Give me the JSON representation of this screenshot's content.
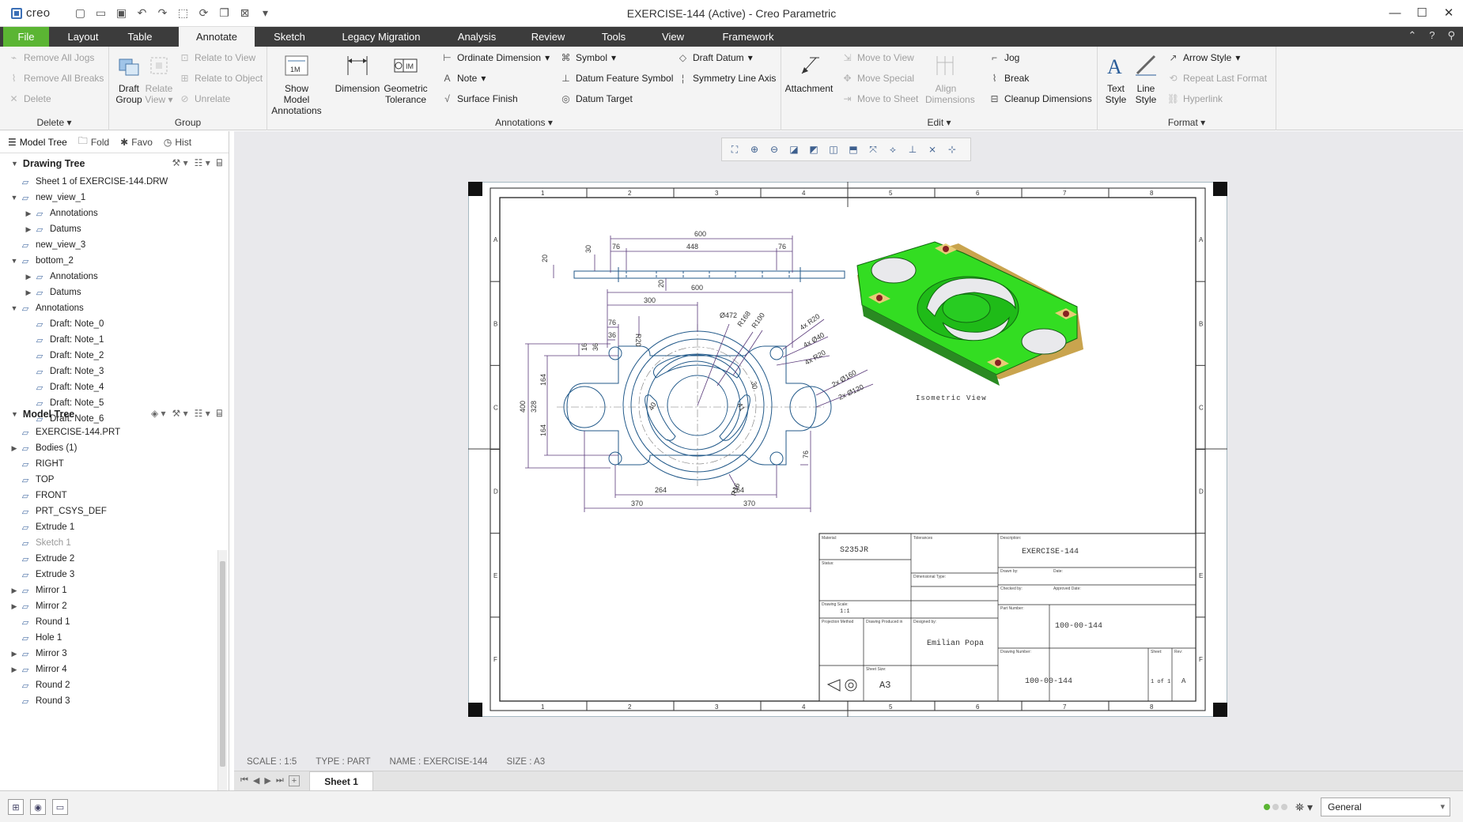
{
  "app": {
    "logo_text": "creo",
    "window_title": "EXERCISE-144 (Active) - Creo Parametric"
  },
  "quick_access": [
    "new-icon",
    "open-icon",
    "save-icon",
    "undo-icon",
    "redo-icon",
    "select-box-icon",
    "regenerate-icon",
    "windows-icon",
    "close-window-icon",
    "customize-icon"
  ],
  "tabs": [
    "File",
    "Layout",
    "Table",
    "Annotate",
    "Sketch",
    "Legacy Migration",
    "Analysis",
    "Review",
    "Tools",
    "View",
    "Framework"
  ],
  "active_tab": "Annotate",
  "ribbon": {
    "delete": {
      "label": "Delete",
      "items": [
        "Remove All Jogs",
        "Remove All Breaks",
        "Delete"
      ]
    },
    "group": {
      "label": "Group",
      "draft_group": "Draft Group",
      "relate_view": "Relate View",
      "items": [
        "Relate to View",
        "Relate to Object",
        "Unrelate"
      ]
    },
    "annotations": {
      "label": "Annotations",
      "show_model_annotations": "Show Model Annotations",
      "dimension": "Dimension",
      "geometric_tolerance": "Geometric Tolerance",
      "col1": [
        "Ordinate Dimension",
        "Note",
        "Surface Finish"
      ],
      "col2": [
        "Symbol",
        "Datum Feature Symbol",
        "Datum Target"
      ],
      "col3": [
        "Draft Datum",
        "Symmetry Line Axis"
      ]
    },
    "edit": {
      "label": "Edit",
      "attachment": "Attachment",
      "align_dimensions": "Align Dimensions",
      "col1": [
        "Move to View",
        "Move Special",
        "Move to Sheet"
      ],
      "col2": [
        "Jog",
        "Break",
        "Cleanup Dimensions"
      ]
    },
    "format": {
      "label": "Format",
      "text_style": "Text Style",
      "line_style": "Line Style",
      "items": [
        "Arrow Style",
        "Repeat Last Format",
        "Hyperlink"
      ]
    }
  },
  "nav_tabs": [
    "Model Tree",
    "Fold",
    "Favo",
    "Hist"
  ],
  "drawing_tree": {
    "title": "Drawing Tree",
    "rows": [
      {
        "label": "Sheet 1 of EXERCISE-144.DRW",
        "indent": 0,
        "exp": ""
      },
      {
        "label": "new_view_1",
        "indent": 0,
        "exp": "▼"
      },
      {
        "label": "Annotations",
        "indent": 1,
        "exp": "▶"
      },
      {
        "label": "Datums",
        "indent": 1,
        "exp": "▶"
      },
      {
        "label": "new_view_3",
        "indent": 0,
        "exp": ""
      },
      {
        "label": "bottom_2",
        "indent": 0,
        "exp": "▼"
      },
      {
        "label": "Annotations",
        "indent": 1,
        "exp": "▶"
      },
      {
        "label": "Datums",
        "indent": 1,
        "exp": "▶"
      },
      {
        "label": "Annotations",
        "indent": 0,
        "exp": "▼"
      },
      {
        "label": "Draft: Note_0",
        "indent": 1,
        "exp": ""
      },
      {
        "label": "Draft: Note_1",
        "indent": 1,
        "exp": ""
      },
      {
        "label": "Draft: Note_2",
        "indent": 1,
        "exp": ""
      },
      {
        "label": "Draft: Note_3",
        "indent": 1,
        "exp": ""
      },
      {
        "label": "Draft: Note_4",
        "indent": 1,
        "exp": ""
      },
      {
        "label": "Draft: Note_5",
        "indent": 1,
        "exp": ""
      },
      {
        "label": "Draft: Note_6",
        "indent": 1,
        "exp": ""
      }
    ]
  },
  "model_tree": {
    "title": "Model Tree",
    "rows": [
      {
        "label": "EXERCISE-144.PRT",
        "exp": ""
      },
      {
        "label": "Bodies (1)",
        "exp": "▶"
      },
      {
        "label": "RIGHT",
        "exp": ""
      },
      {
        "label": "TOP",
        "exp": ""
      },
      {
        "label": "FRONT",
        "exp": ""
      },
      {
        "label": "PRT_CSYS_DEF",
        "exp": ""
      },
      {
        "label": "Extrude 1",
        "exp": ""
      },
      {
        "label": "Sketch 1",
        "exp": "",
        "dim": true
      },
      {
        "label": "Extrude 2",
        "exp": ""
      },
      {
        "label": "Extrude 3",
        "exp": ""
      },
      {
        "label": "Mirror 1",
        "exp": "▶"
      },
      {
        "label": "Mirror 2",
        "exp": "▶"
      },
      {
        "label": "Round 1",
        "exp": ""
      },
      {
        "label": "Hole 1",
        "exp": ""
      },
      {
        "label": "Mirror 3",
        "exp": "▶"
      },
      {
        "label": "Mirror 4",
        "exp": "▶"
      },
      {
        "label": "Round 2",
        "exp": ""
      },
      {
        "label": "Round 3",
        "exp": ""
      }
    ]
  },
  "drawing": {
    "zones_top": [
      "1",
      "2",
      "3",
      "4",
      "5",
      "6",
      "7",
      "8"
    ],
    "zones_side": [
      "A",
      "B",
      "C",
      "D",
      "E",
      "F"
    ],
    "dims": {
      "top_600": "600",
      "top_448": "448",
      "top_76a": "76",
      "top_76b": "76",
      "top_20a": "20",
      "top_30": "30",
      "top_20b": "20",
      "w600": "600",
      "w300": "300",
      "w76": "76",
      "w36": "36",
      "h36": "36",
      "h16": "16",
      "h400": "400",
      "h328": "328",
      "h164a": "164",
      "h164b": "164",
      "r20": "R20",
      "d472": "Ø472",
      "r168": "R168",
      "r100": "R100",
      "d40": "40",
      "d41": "41",
      "d30": "30",
      "r16": "R16",
      "h76": "76",
      "b264a": "264",
      "b264b": "264",
      "b370a": "370",
      "b370b": "370",
      "c4r20": "4x R20",
      "c4d40": "4x Ø40",
      "c4r20b": "4x R20",
      "c2d160": "2x Ø160",
      "c2d120": "2x Ø120"
    },
    "iso_label": "Isometric View",
    "title_block": {
      "material": "S235JR",
      "title": "EXERCISE-144",
      "part_no": "100-00-144",
      "drawing_no": "100-00-144",
      "designer": "Emilian Popa",
      "size": "A3",
      "rev": "A",
      "scale": "1:1",
      "sheet": "1 of 1"
    }
  },
  "colors": {
    "part_green": "#33dd22",
    "face_tan": "#e8cc77",
    "hole_red": "#882222",
    "dim_purple": "#5a3a7a",
    "geom_blue": "#235a8a"
  },
  "status": {
    "scale": "SCALE : 1:5",
    "type": "TYPE : PART",
    "name": "NAME : EXERCISE-144",
    "size": "SIZE : A3"
  },
  "sheet_tab": "Sheet 1",
  "filter": "General"
}
